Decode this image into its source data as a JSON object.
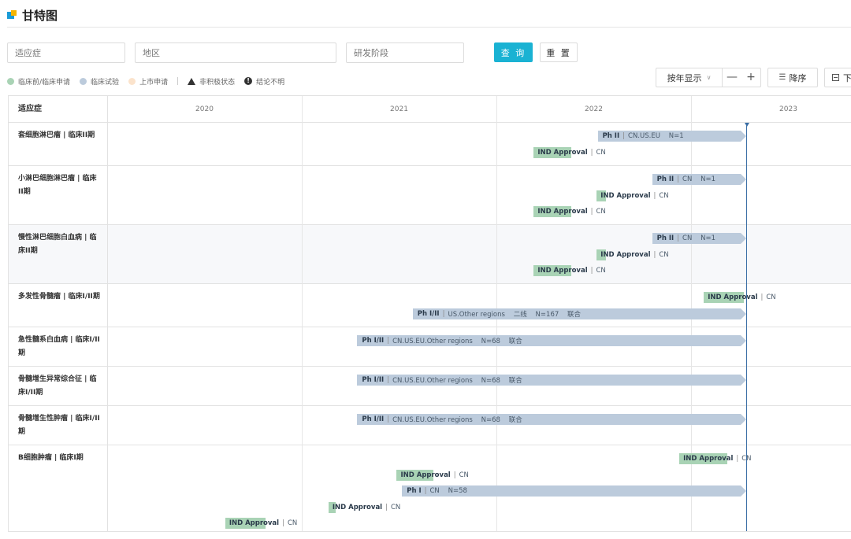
{
  "page": {
    "title": "甘特图"
  },
  "filters": {
    "indication_placeholder": "适应症",
    "region_placeholder": "地区",
    "phase_placeholder": "研发阶段",
    "query_label": "查 询",
    "reset_label": "重 置"
  },
  "legend": {
    "items": [
      {
        "label": "临床前/临床申请",
        "color": "#a9d3b5"
      },
      {
        "label": "临床试验",
        "color": "#bccbdc"
      },
      {
        "label": "上市申请",
        "color": "#fbe3cc"
      }
    ],
    "inactive_label": "非积极状态",
    "unclear_label": "结论不明",
    "inactive_icon": "triangle-icon",
    "unclear_icon": "exclamation-icon"
  },
  "toolbar": {
    "view_mode": "按年显示",
    "zoom_out": "—",
    "zoom_in": "+",
    "sort_label": "降序",
    "sort_icon": "sort-list-icon",
    "export_label": "下载"
  },
  "table": {
    "header_label": "适应症",
    "years": [
      "2020",
      "2021",
      "2022",
      "2023"
    ],
    "rows": [
      {
        "label": "套细胞淋巴瘤 | 临床II期",
        "bars": [
          {
            "type": "trial",
            "stage": "Ph II",
            "info": "CN.US.EU    N=1",
            "start": "2022-07-10",
            "end": "2023-04-15"
          },
          {
            "type": "ind",
            "stage": "IND Approval",
            "info": "CN",
            "start": "2022-03-12",
            "end": "2022-05-22"
          }
        ]
      },
      {
        "label": "小淋巴细胞淋巴瘤 | 临床II期",
        "bars": [
          {
            "type": "trial",
            "stage": "Ph II",
            "info": "CN    N=1",
            "start": "2022-10-20",
            "end": "2023-04-15"
          },
          {
            "type": "ind",
            "stage": "IND Approval",
            "info": "CN",
            "start": "2022-07-08",
            "end": "2022-07-25"
          },
          {
            "type": "ind",
            "stage": "IND Approval",
            "info": "CN",
            "start": "2022-03-12",
            "end": "2022-05-22"
          }
        ]
      },
      {
        "label": "慢性淋巴细胞白血病 | 临床II期",
        "bars": [
          {
            "type": "trial",
            "stage": "Ph II",
            "info": "CN    N=1",
            "start": "2022-10-20",
            "end": "2023-04-15"
          },
          {
            "type": "ind",
            "stage": "IND Approval",
            "info": "CN",
            "start": "2022-07-08",
            "end": "2022-07-25"
          },
          {
            "type": "ind",
            "stage": "IND Approval",
            "info": "CN",
            "start": "2022-03-12",
            "end": "2022-05-22"
          }
        ]
      },
      {
        "label": "多发性骨髓瘤 | 临床I/II期",
        "bars": [
          {
            "type": "ind",
            "stage": "IND Approval",
            "info": "CN",
            "start": "2023-01-25",
            "end": "2023-04-10"
          },
          {
            "type": "trial",
            "stage": "Ph I/II",
            "info": "US.Other regions    二线    N=167    联合",
            "start": "2021-07-28",
            "end": "2023-04-15"
          }
        ]
      },
      {
        "label": "急性髓系白血病 | 临床I/II期",
        "bars": [
          {
            "type": "trial",
            "stage": "Ph I/II",
            "info": "CN.US.EU.Other regions    N=68    联合",
            "start": "2021-04-15",
            "end": "2023-04-15"
          }
        ]
      },
      {
        "label": "骨髓增生异常综合征 | 临床I/II期",
        "bars": [
          {
            "type": "trial",
            "stage": "Ph I/II",
            "info": "CN.US.EU.Other regions    N=68    联合",
            "start": "2021-04-15",
            "end": "2023-04-15"
          }
        ]
      },
      {
        "label": "骨髓增生性肿瘤 | 临床I/II期",
        "bars": [
          {
            "type": "trial",
            "stage": "Ph I/II",
            "info": "CN.US.EU.Other regions    N=68    联合",
            "start": "2021-04-15",
            "end": "2023-04-15"
          }
        ]
      },
      {
        "label": "B细胞肿瘤 | 临床I期",
        "bars": [
          {
            "type": "ind",
            "stage": "IND Approval",
            "info": "CN",
            "start": "2022-12-10",
            "end": "2023-03-10"
          },
          {
            "type": "ind",
            "stage": "IND Approval",
            "info": "CN",
            "start": "2021-06-28",
            "end": "2021-09-05"
          },
          {
            "type": "trial",
            "stage": "Ph I",
            "info": "CN    N=58",
            "start": "2021-07-08",
            "end": "2023-04-15"
          },
          {
            "type": "ind",
            "stage": "IND Approval",
            "info": "CN",
            "start": "2021-02-20",
            "end": "2021-03-05"
          },
          {
            "type": "ind",
            "stage": "IND Approval",
            "info": "CN",
            "start": "2020-08-10",
            "end": "2020-10-25"
          }
        ]
      }
    ],
    "today": "2023-04-15"
  }
}
